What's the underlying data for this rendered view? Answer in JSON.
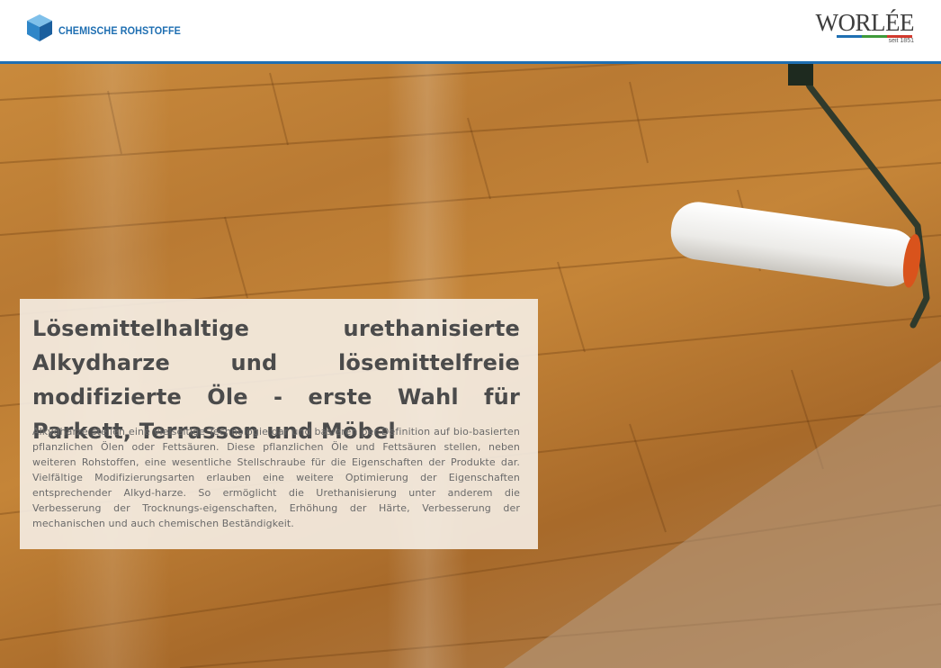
{
  "header": {
    "brand_label": "CHEMISCHE ROHSTOFFE",
    "brand_icon": "cube-icon",
    "logo_word": "WORLÉE",
    "logo_since": "seit 1851",
    "colors": {
      "brand_blue": "#1f6fb2",
      "logo_bar_blue": "#1f6fb2",
      "logo_bar_green": "#3f9a3a",
      "logo_bar_red": "#d23a2e"
    }
  },
  "hero": {
    "image": "wood-floor-paint-roller-photo",
    "title": "Lösemittelhaltige urethanisierte Alkydharze und lösemittelfreie modifizierte Öle - erste Wahl für Parkett, Terrassen und Möbel",
    "body": "Alkydharze stellen eine vielseitige Technologie dar und basieren per Definition auf bio-basierten pflanzlichen Ölen oder Fettsäuren. Diese pflanzlichen Öle und Fettsäuren stellen, neben weiteren Rohstoffen, eine wesentliche Stellschraube für die Eigenschaften der Produkte dar. Vielfältige Modifizierungsarten erlauben eine weitere Optimierung der Eigenschaften entsprechender Alkyd-harze. So ermöglicht die Urethanisierung unter anderem die Verbesserung der Trocknungs-eigenschaften, Erhöhung der Härte, Verbesserung der mechanischen und auch chemischen Beständigkeit."
  }
}
